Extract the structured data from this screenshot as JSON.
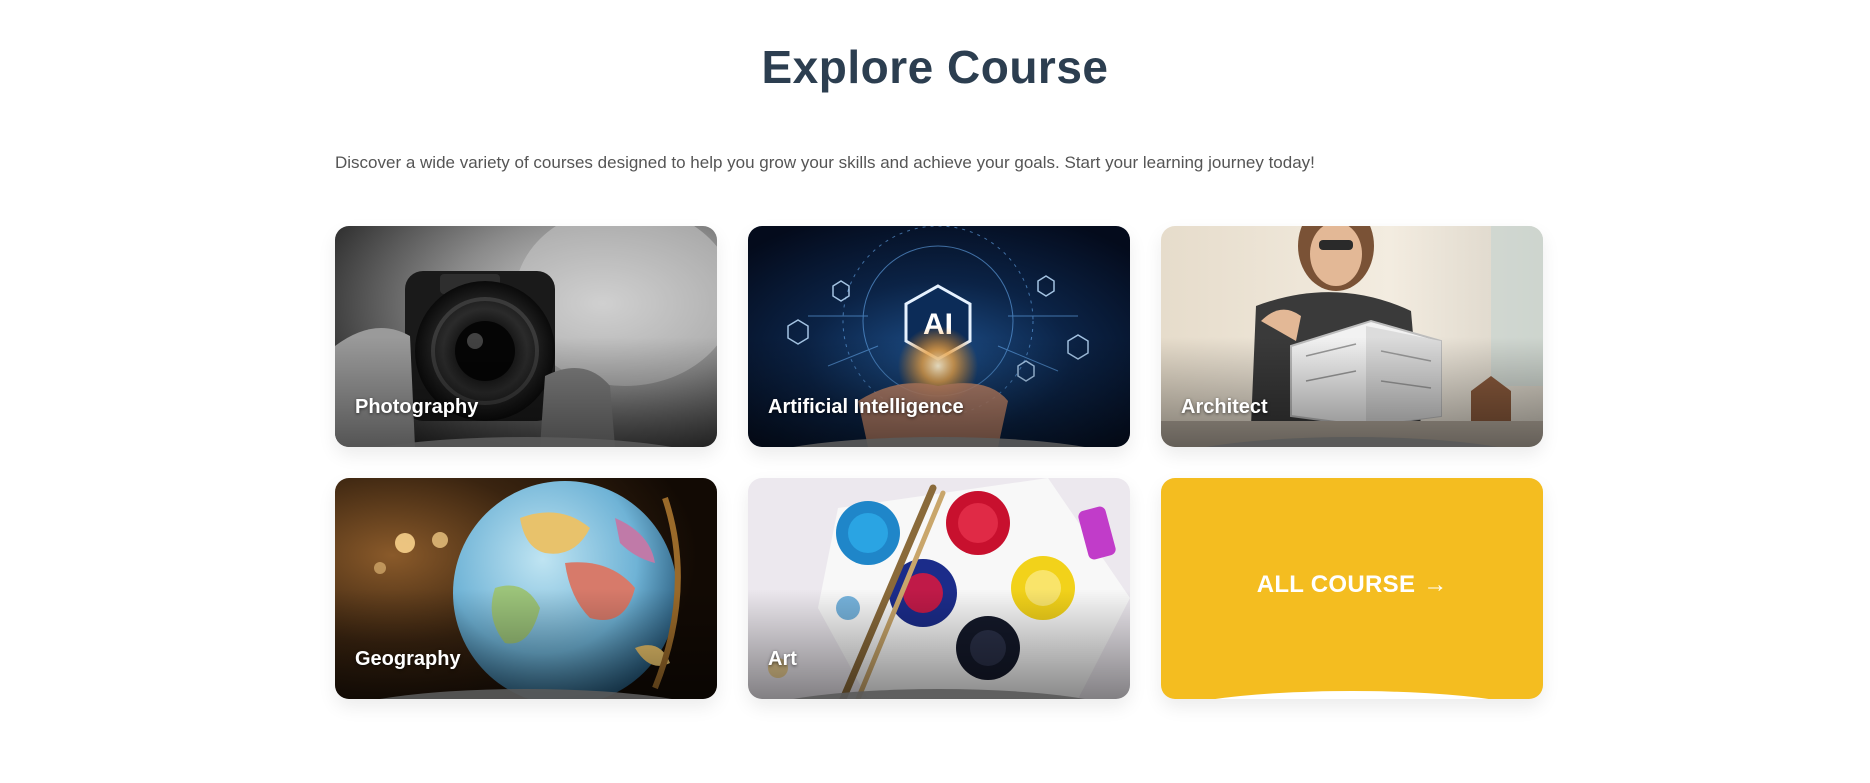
{
  "section": {
    "title": "Explore Course",
    "subtitle": "Discover a wide variety of courses designed to help you grow your skills and achieve your goals. Start your learning journey today!"
  },
  "courses": [
    {
      "label": "Photography",
      "image": "camera-photo"
    },
    {
      "label": "Artificial Intelligence",
      "image": "ai-hand-photo"
    },
    {
      "label": "Architect",
      "image": "architect-model-photo"
    },
    {
      "label": "Geography",
      "image": "globe-photo"
    },
    {
      "label": "Art",
      "image": "paint-palette-photo"
    }
  ],
  "all_course": {
    "label": "ALL COURSE",
    "arrow": "→"
  },
  "colors": {
    "title": "#2c3e50",
    "accent": "#f4bd20",
    "subtitle": "#555555"
  }
}
